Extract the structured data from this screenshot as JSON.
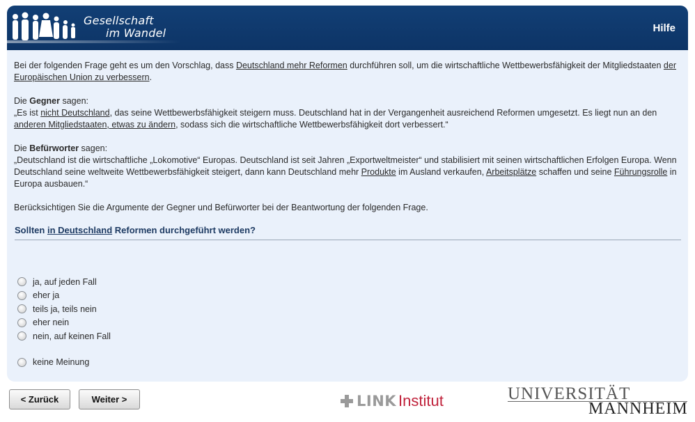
{
  "header": {
    "logo_line1": "Gesellschaft",
    "logo_line2": "im Wandel",
    "help": "Hilfe"
  },
  "intro": {
    "t1": "Bei der folgenden Frage geht es um den Vorschlag, dass ",
    "l1": "Deutschland mehr Reformen",
    "t2": " durchführen soll, um die wirtschaftliche Wettbewerbsfähigkeit der Mitgliedstaaten ",
    "l2": "der Europäischen Union zu verbessern",
    "t3": "."
  },
  "opponents": {
    "pre": "Die ",
    "who": "Gegner",
    "post": " sagen:",
    "q1": "„Es ist ",
    "l1": "nicht Deutschland",
    "q2": ", das seine Wettbewerbsfähigkeit steigern muss. Deutschland hat in der Vergangenheit ausreichend Reformen umgesetzt. Es liegt nun an den ",
    "l2": "anderen Mitgliedstaaten, etwas zu ändern",
    "q3": ", sodass sich die wirtschaftliche Wettbewerbsfähigkeit dort verbessert.“"
  },
  "supporters": {
    "pre": "Die ",
    "who": "Befürworter",
    "post": " sagen:",
    "q1": "„Deutschland ist die wirtschaftliche „Lokomotive“ Europas. Deutschland ist seit Jahren „Exportweltmeister“ und stabilisiert mit seinen wirtschaftlichen Erfolgen Europa. Wenn Deutschland seine weltweite Wettbewerbsfähigkeit steigert, dann kann Deutschland mehr ",
    "l1": "Produkte",
    "q2": " im Ausland verkaufen, ",
    "l2": "Arbeitsplätze",
    "q3": " schaffen und seine ",
    "l3": "Führungsrolle",
    "q4": " in Europa ausbauen.“"
  },
  "instruction": "Berücksichtigen Sie die Argumente der Gegner und Befürworter bei der Beantwortung der folgenden Frage.",
  "question": {
    "pre": "Sollten ",
    "link": "in Deutschland",
    "post": " Reformen durchgeführt werden?"
  },
  "options": [
    "ja, auf jeden Fall",
    "eher ja",
    "teils ja, teils nein",
    "eher nein",
    "nein, auf keinen Fall",
    "keine Meinung"
  ],
  "buttons": {
    "back": "< Zurück",
    "next": "Weiter >"
  },
  "footer": {
    "link_word": "LINK",
    "link_inst": "Institut",
    "uni1": "UNIVERSITÄT",
    "uni2": "MANNHEIM"
  },
  "colors": {
    "header": "#0d3466",
    "panel": "#eaf1fb",
    "link_red": "#c0223b"
  }
}
